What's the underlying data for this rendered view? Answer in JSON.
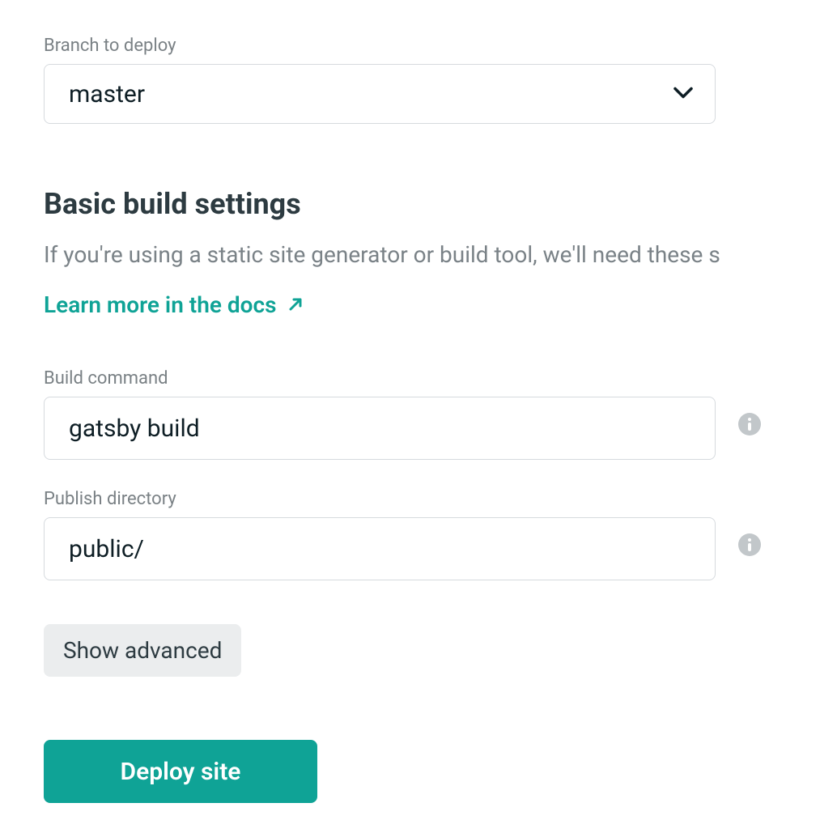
{
  "branch": {
    "label": "Branch to deploy",
    "value": "master"
  },
  "section": {
    "heading": "Basic build settings",
    "description": "If you're using a static site generator or build tool, we'll need these s",
    "learn_link": "Learn more in the docs"
  },
  "build_command": {
    "label": "Build command",
    "value": "gatsby build"
  },
  "publish_dir": {
    "label": "Publish directory",
    "value": "public/"
  },
  "buttons": {
    "show_advanced": "Show advanced",
    "deploy": "Deploy site"
  },
  "colors": {
    "accent": "#0fa396",
    "text_muted": "#7a8185",
    "text_dark": "#2d3b41",
    "border": "#d6dade",
    "btn_secondary_bg": "#ebedee"
  }
}
